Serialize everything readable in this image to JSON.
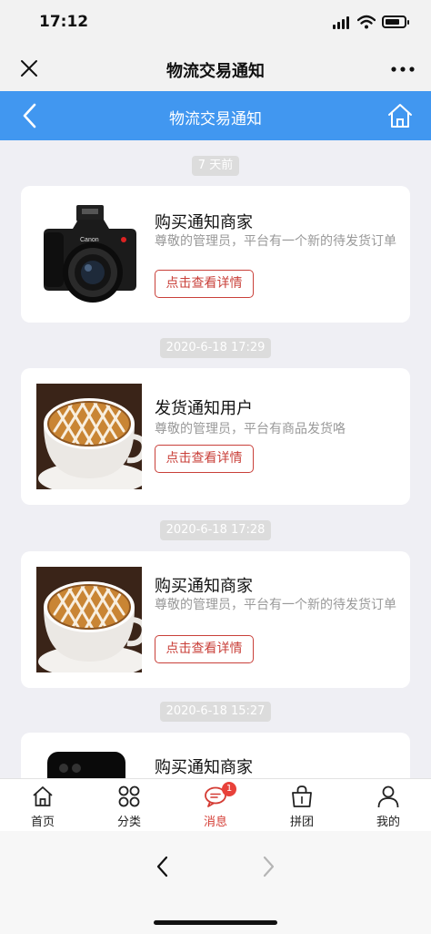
{
  "status_bar": {
    "time": "17:12"
  },
  "wechat_bar": {
    "title": "物流交易通知",
    "close_icon": "close-icon",
    "more_icon": "more-icon"
  },
  "app_bar": {
    "title": "物流交易通知",
    "back_icon": "chevron-left-icon",
    "home_icon": "home-icon"
  },
  "feed": [
    {
      "time": "7 天前",
      "title": "购买通知商家",
      "desc": "尊敬的管理员，平台有一个新的待发货订单",
      "button": "点击查看详情",
      "image": "camera-photo"
    },
    {
      "time": "2020-6-18 17:29",
      "title": "发货通知用户",
      "desc": "尊敬的管理员，平台有商品发货咯",
      "button": "点击查看详情",
      "image": "coffee-photo"
    },
    {
      "time": "2020-6-18 17:28",
      "title": "购买通知商家",
      "desc": "尊敬的管理员，平台有一个新的待发货订单",
      "button": "点击查看详情",
      "image": "coffee-photo"
    },
    {
      "time": "2020-6-18 15:27",
      "title": "购买通知商家",
      "image": "phone-photo"
    }
  ],
  "tab_bar": {
    "items": [
      {
        "label": "首页",
        "icon": "home-icon"
      },
      {
        "label": "分类",
        "icon": "category-icon"
      },
      {
        "label": "消息",
        "icon": "message-icon",
        "badge": "1",
        "active": true
      },
      {
        "label": "拼团",
        "icon": "shopping-bag-icon"
      },
      {
        "label": "我的",
        "icon": "user-icon"
      }
    ]
  },
  "colors": {
    "accent": "#4197f0",
    "active_tab": "#d43c34",
    "button_border": "#c9403a"
  }
}
